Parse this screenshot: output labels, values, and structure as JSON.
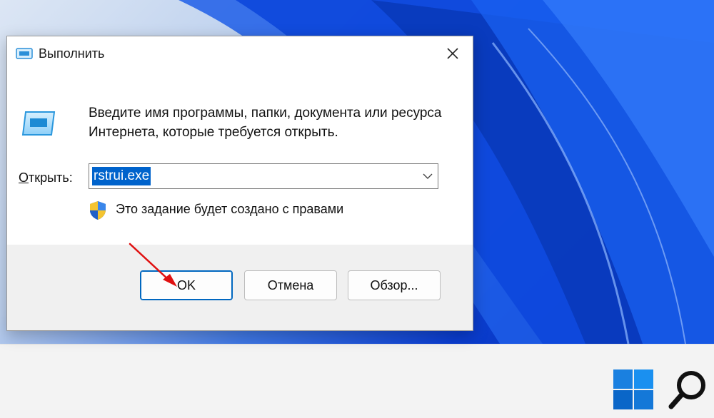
{
  "dialog": {
    "title": "Выполнить",
    "description": "Введите имя программы, папки, документа или ресурса Интернета, которые требуется открыть.",
    "open_label_first": "О",
    "open_label_rest": "ткрыть:",
    "command_value": "rstrui.exe",
    "admin_note": "Это задание будет создано с правами",
    "buttons": {
      "ok": "OK",
      "cancel": "Отмена",
      "browse": "Обзор..."
    }
  },
  "colors": {
    "accent": "#0067c0",
    "selection": "#0063cc",
    "annotation_arrow": "#e01010"
  },
  "icons": {
    "title": "run-icon",
    "body": "run-icon",
    "close": "close-icon",
    "dropdown": "chevron-down-icon",
    "uac": "uac-shield-icon",
    "taskbar_start": "windows-logo-icon",
    "taskbar_search": "search-icon"
  }
}
